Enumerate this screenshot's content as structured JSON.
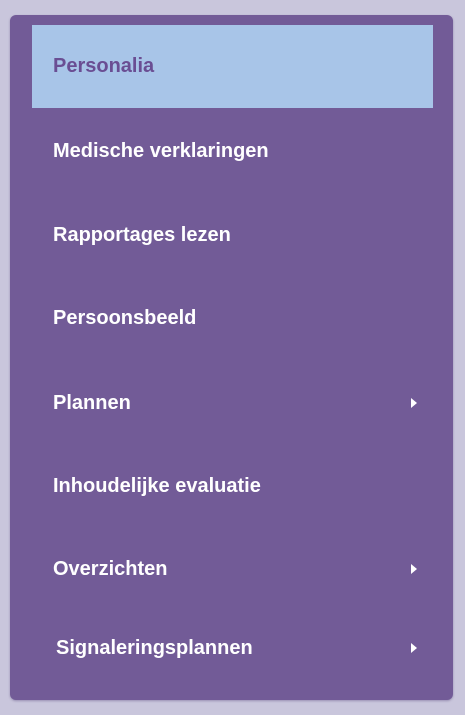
{
  "menu": {
    "items": [
      {
        "label": "Personalia",
        "active": true,
        "has_submenu": false
      },
      {
        "label": "Medische verklaringen",
        "active": false,
        "has_submenu": false
      },
      {
        "label": "Rapportages lezen",
        "active": false,
        "has_submenu": false
      },
      {
        "label": "Persoonsbeeld",
        "active": false,
        "has_submenu": false
      },
      {
        "label": "Plannen",
        "active": false,
        "has_submenu": true
      },
      {
        "label": "Inhoudelijke evaluatie",
        "active": false,
        "has_submenu": false
      },
      {
        "label": "Overzichten",
        "active": false,
        "has_submenu": true
      },
      {
        "label": "Signaleringsplannen",
        "active": false,
        "has_submenu": true
      }
    ],
    "icons": {
      "submenu": "triangle-right-icon"
    }
  },
  "colors": {
    "panel_background": "#725b97",
    "active_item_background": "#a8c5e8",
    "active_item_text": "#6a4e93",
    "item_text": "#ffffff",
    "page_background": "#c9c6dc"
  }
}
